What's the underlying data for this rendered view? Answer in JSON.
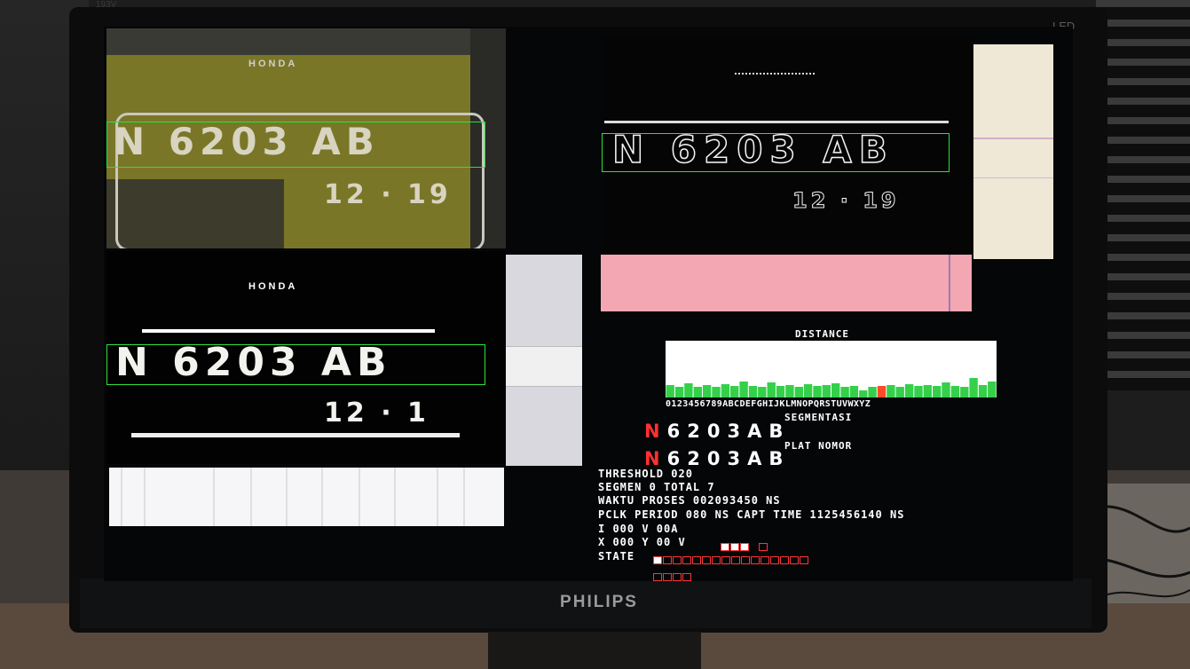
{
  "monitor": {
    "brand": "PHILIPS",
    "indicator": "LED",
    "model": "193V"
  },
  "plates": {
    "brand_text": "HONDA",
    "plate_main": "N 6203 AB",
    "plate_expiry": "12 · 19",
    "binary_expiry": "12 · 1"
  },
  "distance": {
    "title": "DISTANCE",
    "axis_labels": "0123456789ABCDEFGHIJKLMNOPQRSTUVWXYZ",
    "highlight_char": "N"
  },
  "segmentasi": {
    "title": "SEGMENTASI",
    "chars": [
      "N",
      "6",
      "2",
      "0",
      "3",
      "A",
      "B"
    ]
  },
  "plat_nomor": {
    "title": "PLAT NOMOR",
    "chars": [
      "N",
      "6",
      "2",
      "0",
      "3",
      "A",
      "B"
    ]
  },
  "info": {
    "threshold": "THRESHOLD 020",
    "segmen": "SEGMEN 0 TOTAL 7",
    "waktu": "WAKTU PROSES 002093450 NS",
    "pclk": "PCLK PERIOD 080 NS CAPT TIME 1125456140 NS",
    "coord1": "I 000 V 00A",
    "coord2": "X 000 Y 00 V",
    "state": "STATE"
  },
  "state_progress": 0.05,
  "colors": {
    "bbox_green": "#2ee03a",
    "bbox_blue": "#3a3ae8",
    "highlight_red": "#ff3030"
  }
}
